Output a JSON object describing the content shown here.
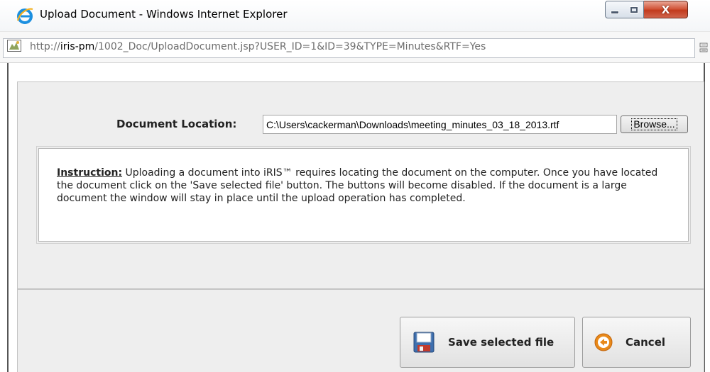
{
  "window": {
    "title": "Upload Document - Windows Internet Explorer",
    "icon": "ie-icon",
    "controls": {
      "minimize": "minimize-icon",
      "maximize": "maximize-icon",
      "close": "X"
    }
  },
  "address_bar": {
    "prefix": "http://",
    "host": "iris-pm",
    "path": "/1002_Doc/UploadDocument.jsp?USER_ID=1&ID=39&TYPE=Minutes&RTF=Yes"
  },
  "form": {
    "document_location_label": "Document Location:",
    "document_location_value": "C:\\Users\\cackerman\\Downloads\\meeting_minutes_03_18_2013.rtf",
    "browse_label": "Browse..."
  },
  "instruction": {
    "heading": "Instruction:",
    "body": " Uploading a document into iRIS™ requires locating the document on the computer. Once you have located the document click on the 'Save selected file' button. The buttons will become disabled. If the document is a large document the window will stay in place until the upload operation has completed."
  },
  "actions": {
    "save_label": "Save selected file",
    "cancel_label": "Cancel"
  },
  "colors": {
    "panel_bg": "#eeeeee",
    "close_button": "#c94a2d",
    "cancel_icon": "#e8891a",
    "save_icon": "#3e6fae"
  }
}
